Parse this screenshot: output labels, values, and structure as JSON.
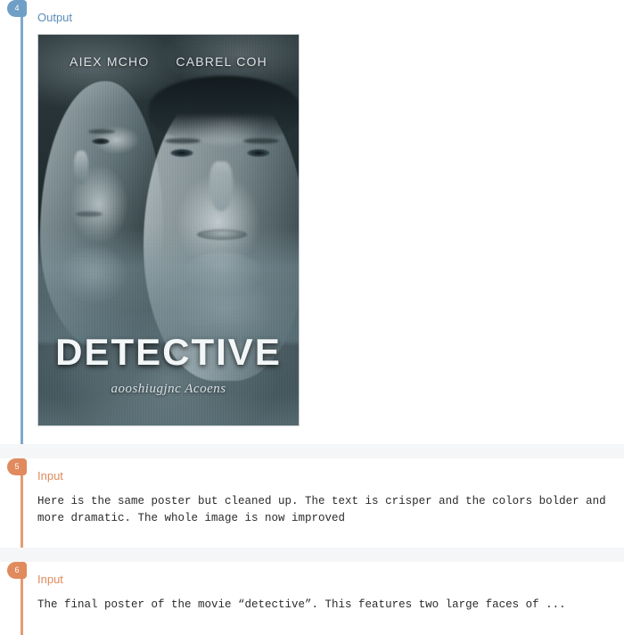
{
  "steps": [
    {
      "number": "4",
      "kind": "Output",
      "label": "Output",
      "accent": "#6f9fc6"
    },
    {
      "number": "5",
      "kind": "Input",
      "label": "Input",
      "accent": "#e08a5d",
      "text": "Here is the same poster but cleaned up. The text is crisper and the colors bolder and more dramatic. The whole image is now improved"
    },
    {
      "number": "6",
      "kind": "Input",
      "label": "Input",
      "accent": "#e08a5d",
      "text": "The final poster of the movie “detective”. This features two large faces of ..."
    }
  ],
  "poster": {
    "credit_left": "AIEX MCHO",
    "credit_right": "CABREL COH",
    "title": "DETECTIVE",
    "subtitle": "аooshiugjnc Acoenѕ"
  }
}
